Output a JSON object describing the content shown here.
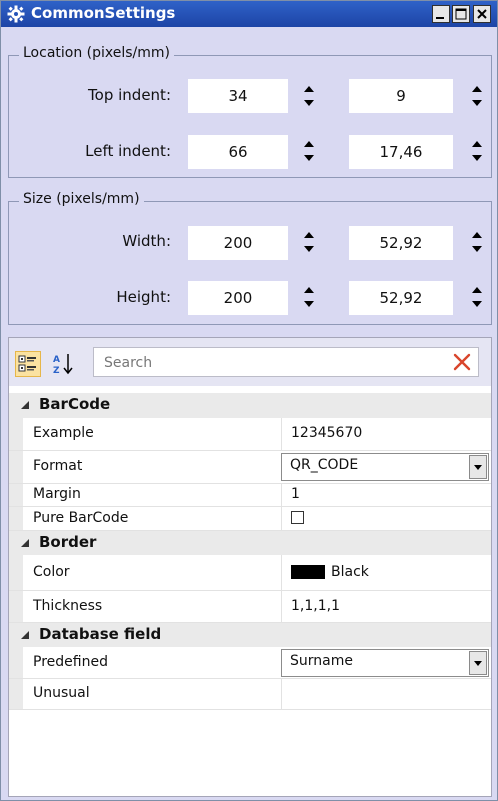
{
  "window": {
    "title": "CommonSettings",
    "icon": "gear-icon",
    "title_bar_color": "#2453b8",
    "controls": [
      "minimize",
      "maximize",
      "close"
    ]
  },
  "location": {
    "label": "Location (pixels/mm)",
    "top_indent": {
      "label": "Top indent:",
      "pixels": "34",
      "mm": "9"
    },
    "left_indent": {
      "label": "Left indent:",
      "pixels": "66",
      "mm": "17,46"
    }
  },
  "size": {
    "label": "Size (pixels/mm)",
    "width": {
      "label": "Width:",
      "pixels": "200",
      "mm": "52,92"
    },
    "height": {
      "label": "Height:",
      "pixels": "200",
      "mm": "52,92"
    }
  },
  "property_grid": {
    "search_placeholder": "Search",
    "categories": [
      {
        "name": "BarCode",
        "properties": [
          {
            "name": "Example",
            "value": "12345670",
            "editor": "text"
          },
          {
            "name": "Format",
            "value": "QR_CODE",
            "editor": "dropdown"
          },
          {
            "name": "Margin",
            "value": "1",
            "editor": "text"
          },
          {
            "name": "Pure BarCode",
            "value": "",
            "editor": "checkbox",
            "checked": false
          }
        ]
      },
      {
        "name": "Border",
        "properties": [
          {
            "name": "Color",
            "value": "Black",
            "editor": "color",
            "color": "#000000"
          },
          {
            "name": "Thickness",
            "value": "1,1,1,1",
            "editor": "text"
          }
        ]
      },
      {
        "name": "Database field",
        "properties": [
          {
            "name": "Predefined",
            "value": "Surname",
            "editor": "dropdown"
          },
          {
            "name": "Unusual",
            "value": "",
            "editor": "text"
          }
        ]
      }
    ]
  }
}
